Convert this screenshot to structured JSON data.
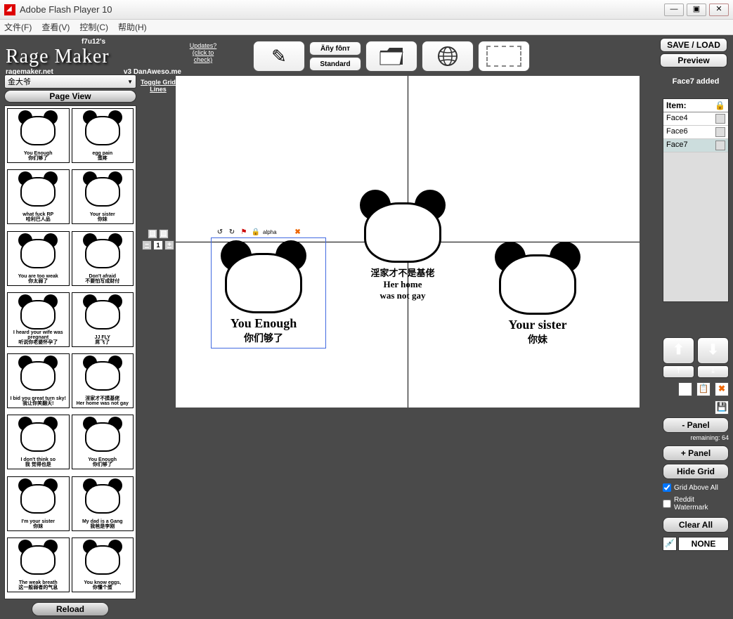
{
  "window": {
    "title": "Adobe Flash Player 10"
  },
  "menus": [
    "文件(F)",
    "查看(V)",
    "控制(C)",
    "帮助(H)"
  ],
  "logo": {
    "sub": "f7u12's",
    "title": "Rage Maker",
    "site": "ragemaker.net",
    "version": "v3 DanAweso.me"
  },
  "updates": "Updates?\n(click to check)",
  "fontBtn": {
    "top": "Äñy fônт",
    "bottom": "Standard"
  },
  "rightTop": {
    "save": "SAVE / LOAD",
    "preview": "Preview"
  },
  "dropdown": "金大爷",
  "pageView": "Page View",
  "toggleGrid": "Toggle Grid Lines",
  "reload": "Reload",
  "thumbs": [
    {
      "en": "You Enough",
      "cn": "你们够了"
    },
    {
      "en": "egg pain",
      "cn": "蛋疼"
    },
    {
      "en": "what fuck RP",
      "cn": "哈利巴人品"
    },
    {
      "en": "Your sister",
      "cn": "你妹"
    },
    {
      "en": "You are too weak",
      "cn": "你太弱了"
    },
    {
      "en": "Don't afraid",
      "cn": "不要怕写成财付"
    },
    {
      "en": "I heard your wife was pregnant",
      "cn": "听说你老婆怀孕了"
    },
    {
      "en": "JJ FLY",
      "cn": "屌飞了"
    },
    {
      "en": "I bid you great turn sky!",
      "cn": "我让你笑翻天!"
    },
    {
      "en": "淫家才不摸基佬",
      "cn": "Her home was not gay"
    },
    {
      "en": "I don't think so",
      "cn": "我 觉得也是"
    },
    {
      "en": "You Enough",
      "cn": "你们够了"
    },
    {
      "en": "I'm your sister",
      "cn": "你妹"
    },
    {
      "en": "My dad is a Gang",
      "cn": "我爸是李刚"
    },
    {
      "en": "The weak breath",
      "cn": "这一般弱者的气息"
    },
    {
      "en": "You know eggs,",
      "cn": "你懂个蛋"
    }
  ],
  "status": "Face7 added",
  "items": {
    "header": "Item:",
    "rows": [
      "Face4",
      "Face6",
      "Face7"
    ],
    "selected": 2
  },
  "panels": {
    "minus": "- Panel",
    "remaining": "remaining: 64",
    "plus": "+ Panel",
    "hide": "Hide Grid",
    "gridAbove": "Grid Above All",
    "reddit": "Reddit Watermark",
    "clear": "Clear All",
    "none": "NONE"
  },
  "canvas": {
    "face1": {
      "t1": "You Enough",
      "t2": "你们够了"
    },
    "face2": {
      "t0": "淫家才不是基佬",
      "t1": "Her home",
      "t2": "was not gay"
    },
    "face3": {
      "t1": "Your sister",
      "t2": "你妹"
    },
    "alpha": "alpha"
  }
}
